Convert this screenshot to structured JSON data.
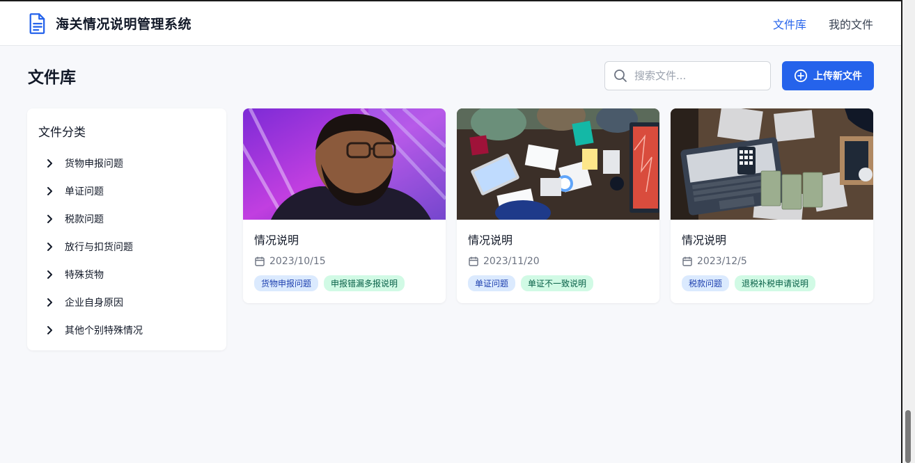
{
  "app": {
    "title": "海关情况说明管理系统"
  },
  "nav": {
    "library": "文件库",
    "my_files": "我的文件"
  },
  "page": {
    "title": "文件库"
  },
  "search": {
    "placeholder": "搜索文件..."
  },
  "upload": {
    "label": "上传新文件"
  },
  "sidebar": {
    "title": "文件分类",
    "items": [
      {
        "label": "货物申报问题"
      },
      {
        "label": "单证问题"
      },
      {
        "label": "税款问题"
      },
      {
        "label": "放行与扣货问题"
      },
      {
        "label": "特殊货物"
      },
      {
        "label": "企业自身原因"
      },
      {
        "label": "其他个别特殊情况"
      }
    ]
  },
  "cards": [
    {
      "title": "情况说明",
      "date": "2023/10/15",
      "tags": [
        "货物申报问题",
        "申报错漏多报说明"
      ]
    },
    {
      "title": "情况说明",
      "date": "2023/11/20",
      "tags": [
        "单证问题",
        "单证不一致说明"
      ]
    },
    {
      "title": "情况说明",
      "date": "2023/12/5",
      "tags": [
        "税款问题",
        "退税补税申请说明"
      ]
    }
  ],
  "colors": {
    "accent": "#2563eb",
    "tag_blue_bg": "#dbeafe",
    "tag_green_bg": "#d1fae5"
  }
}
